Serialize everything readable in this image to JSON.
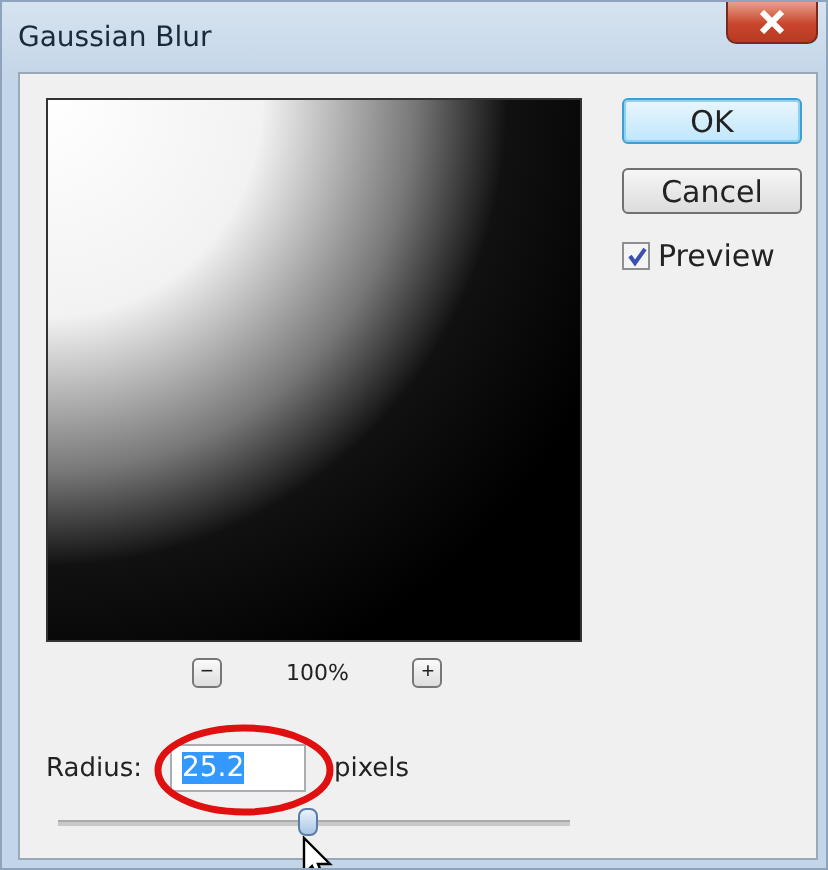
{
  "window": {
    "title": "Gaussian Blur"
  },
  "zoom": {
    "minus": "−",
    "value": "100%",
    "plus": "+"
  },
  "buttons": [
    {
      "label": "OK",
      "default": true
    },
    {
      "label": "Cancel",
      "default": false
    }
  ],
  "preview_option": {
    "label": "Preview",
    "checked": true
  },
  "radius": {
    "label": "Radius:",
    "value": "25.2",
    "unit": "pixels",
    "level": 0.49
  }
}
